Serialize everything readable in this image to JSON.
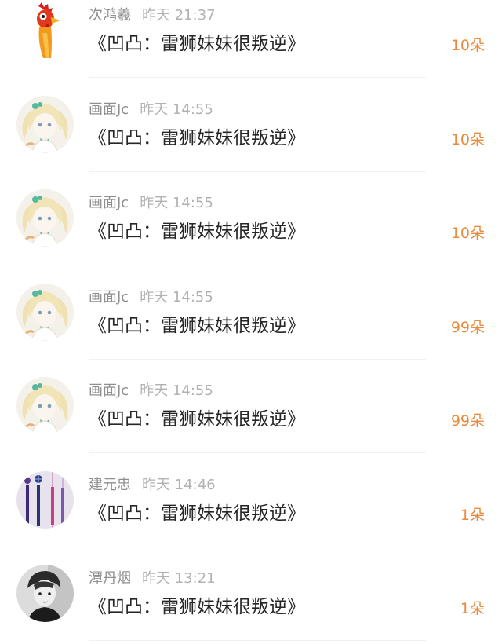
{
  "gifts": [
    {
      "user": "次鸿羲",
      "time": "昨天 21:37",
      "title": "《凹凸：雷狮妹妹很叛逆》",
      "amount": "10朵",
      "avatar": "rooster-avatar"
    },
    {
      "user": "画面Jc",
      "time": "昨天 14:55",
      "title": "《凹凸：雷狮妹妹很叛逆》",
      "amount": "10朵",
      "avatar": "anime-girl-avatar"
    },
    {
      "user": "画面Jc",
      "time": "昨天 14:55",
      "title": "《凹凸：雷狮妹妹很叛逆》",
      "amount": "10朵",
      "avatar": "anime-girl-avatar"
    },
    {
      "user": "画面Jc",
      "time": "昨天 14:55",
      "title": "《凹凸：雷狮妹妹很叛逆》",
      "amount": "99朵",
      "avatar": "anime-girl-avatar"
    },
    {
      "user": "画面Jc",
      "time": "昨天 14:55",
      "title": "《凹凸：雷狮妹妹很叛逆》",
      "amount": "99朵",
      "avatar": "anime-girl-avatar"
    },
    {
      "user": "建元忠",
      "time": "昨天 14:46",
      "title": "《凹凸：雷狮妹妹很叛逆》",
      "amount": "1朵",
      "avatar": "tassel-avatar"
    },
    {
      "user": "潭丹烟",
      "time": "昨天 13:21",
      "title": "《凹凸：雷狮妹妹很叛逆》",
      "amount": "1朵",
      "avatar": "portrait-avatar"
    }
  ],
  "colors": {
    "amount": "#ec8a3c",
    "username": "#8f8f8f",
    "timestamp": "#b2b2b2",
    "title": "#262626",
    "divider": "#f0f0f0"
  }
}
